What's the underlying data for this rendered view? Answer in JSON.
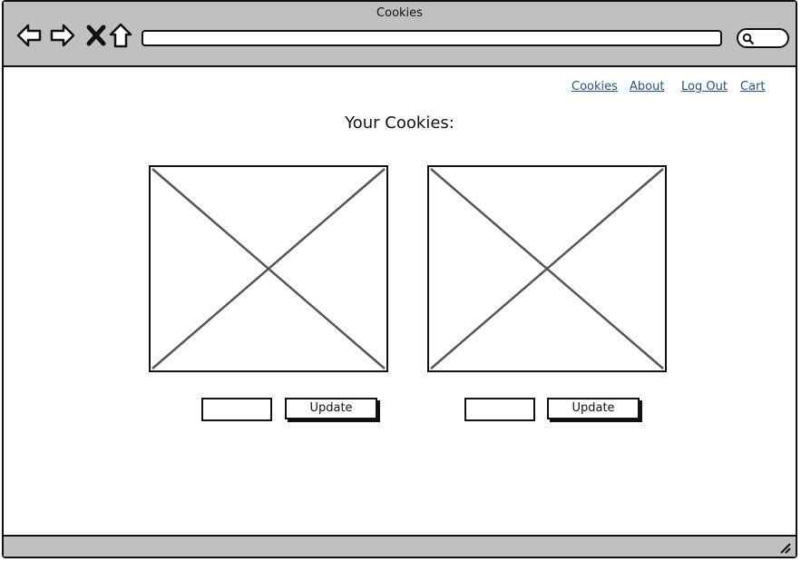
{
  "window": {
    "title": "Cookies"
  },
  "browser": {
    "nav_icons": [
      "back-arrow-icon",
      "forward-arrow-icon",
      "close-x-icon",
      "home-icon"
    ],
    "url_value": "",
    "search_icon": "search-icon"
  },
  "nav": {
    "links": [
      {
        "label": "Cookies"
      },
      {
        "label": "About"
      },
      {
        "label": "Log Out"
      },
      {
        "label": "Cart"
      }
    ]
  },
  "main": {
    "heading": "Your Cookies:",
    "items": [
      {
        "quantity_value": "",
        "button_label": "Update"
      },
      {
        "quantity_value": "",
        "button_label": "Update"
      }
    ]
  },
  "colors": {
    "chrome": "#c0c0c0",
    "link": "#1f4f8f",
    "border": "#111111"
  }
}
